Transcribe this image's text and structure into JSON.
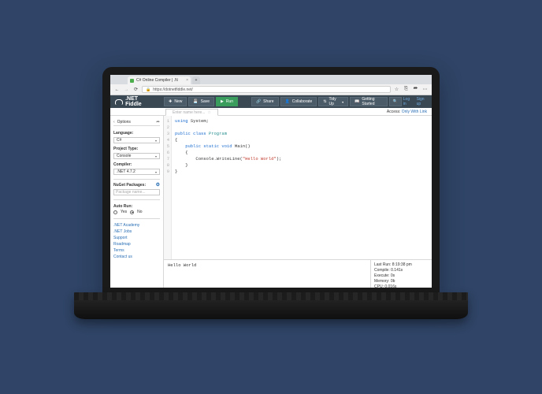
{
  "browser": {
    "tab_title": "C# Online Compiler | .N",
    "url": "https://dotnetfiddle.net/"
  },
  "toolbar": {
    "brand": ".NET Fiddle",
    "new": "New",
    "save": "Save",
    "run": "Run",
    "share": "Share",
    "collaborate": "Collaborate",
    "tidy": "Tidy Up",
    "getting_started": "Getting Started",
    "login": "Log in",
    "signup": "Sign up"
  },
  "subbar": {
    "filename_hint": "Enter name here...",
    "access_label": "Access:",
    "access_value": "Only With Link"
  },
  "sidebar": {
    "options_label": "Options",
    "language_label": "Language:",
    "language_value": "C#",
    "project_label": "Project Type:",
    "project_value": "Console",
    "compiler_label": "Compiler:",
    "compiler_value": ".NET 4.7.2",
    "nuget_label": "NuGet Packages:",
    "nuget_placeholder": "Package name...",
    "autorun_label": "Auto Run:",
    "autorun_yes": "Yes",
    "autorun_no": "No",
    "links": [
      ".NET Academy",
      ".NET Jobs",
      "Support",
      "Roadmap",
      "Terms",
      "Contact us"
    ]
  },
  "code": {
    "line1_kw": "using",
    "line1_rest": " System;",
    "line3_kw": "public class",
    "line3_cls": " Program",
    "line5_kw1": "    public static void",
    "line5_rest": " Main()",
    "line7_call": "        Console.WriteLine(",
    "line7_str": "\"Hello World\"",
    "line7_end": ");"
  },
  "output": {
    "text": "Hello World",
    "stats_lastrun_label": "Last Run:",
    "stats_lastrun_value": "8:19:38 pm",
    "stats_compile_label": "Compile:",
    "stats_compile_value": "0.141s",
    "stats_execute_label": "Execute:",
    "stats_execute_value": "0s",
    "stats_memory_label": "Memory:",
    "stats_memory_value": "0b",
    "stats_cpu_label": "CPU:",
    "stats_cpu_value": "0.016s"
  }
}
